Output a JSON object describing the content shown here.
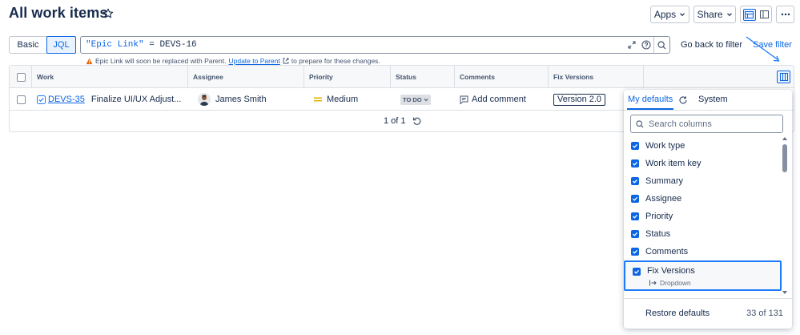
{
  "header": {
    "title": "All work items",
    "apps_label": "Apps",
    "share_label": "Share"
  },
  "filter": {
    "basic_label": "Basic",
    "jql_label": "JQL",
    "query_field": "\"Epic Link\"",
    "query_operator": " = ",
    "query_value": "DEVS-16",
    "go_back_label": "Go back to filter",
    "save_filter_label": "Save filter",
    "warning_text": "Epic Link will soon be replaced with Parent.",
    "warning_link": "Update to Parent",
    "warning_suffix": "to prepare for these changes."
  },
  "table": {
    "columns": [
      "Work",
      "Assignee",
      "Priority",
      "Status",
      "Comments",
      "Fix Versions"
    ],
    "rows": [
      {
        "key": "DEVS-35",
        "summary": "Finalize UI/UX Adjust...",
        "assignee": "James Smith",
        "priority": "Medium",
        "status": "TO DO",
        "comments": "Add comment",
        "fix_version": "Version 2.0"
      }
    ],
    "pagination": "1 of 1"
  },
  "column_picker": {
    "tabs": [
      "My defaults",
      "System"
    ],
    "search_placeholder": "Search columns",
    "items": [
      {
        "label": "Work type",
        "checked": true
      },
      {
        "label": "Work item key",
        "checked": true
      },
      {
        "label": "Summary",
        "checked": true
      },
      {
        "label": "Assignee",
        "checked": true
      },
      {
        "label": "Priority",
        "checked": true
      },
      {
        "label": "Status",
        "checked": true
      },
      {
        "label": "Comments",
        "checked": true
      },
      {
        "label": "Fix Versions",
        "checked": true,
        "sublabel": "Dropdown"
      }
    ],
    "restore_label": "Restore defaults",
    "count": "33 of 131"
  },
  "colors": {
    "accent": "#0c66e4",
    "text": "#172b4d",
    "subtle": "#44546f",
    "priority_medium": "#e2b203",
    "warning": "#e56910"
  }
}
